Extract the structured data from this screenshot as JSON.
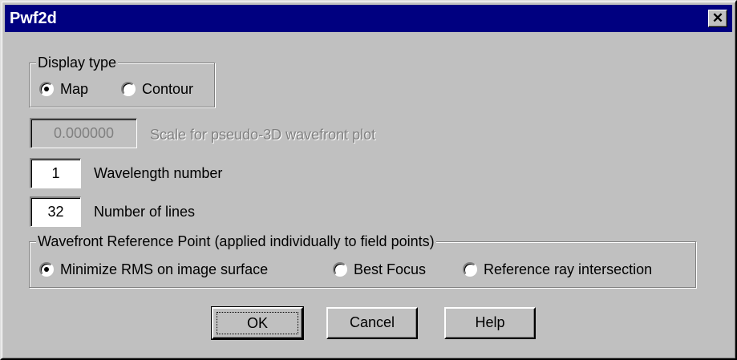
{
  "window": {
    "title": "Pwf2d",
    "close_glyph": "✕"
  },
  "display_type": {
    "legend": "Display type",
    "options": [
      {
        "label": "Map",
        "checked": true
      },
      {
        "label": "Contour",
        "checked": false
      }
    ]
  },
  "scale": {
    "value": "0.000000",
    "label": "Scale for pseudo-3D wavefront plot",
    "enabled": false
  },
  "wavelength": {
    "value": "1",
    "label": "Wavelength number"
  },
  "lines": {
    "value": "32",
    "label": "Number of lines"
  },
  "reference_point": {
    "legend": "Wavefront Reference Point (applied individually to field points)",
    "options": [
      {
        "label": "Minimize RMS on image surface",
        "checked": true
      },
      {
        "label": "Best Focus",
        "checked": false
      },
      {
        "label": "Reference ray intersection",
        "checked": false
      }
    ]
  },
  "buttons": {
    "ok": "OK",
    "cancel": "Cancel",
    "help": "Help"
  },
  "colors": {
    "titlebar": "#000080",
    "face": "#c0c0c0",
    "disabled_text": "#808080"
  },
  "icons": {
    "close": "close-icon",
    "radio_checked": "radio-checked-icon",
    "radio_unchecked": "radio-unchecked-icon"
  }
}
